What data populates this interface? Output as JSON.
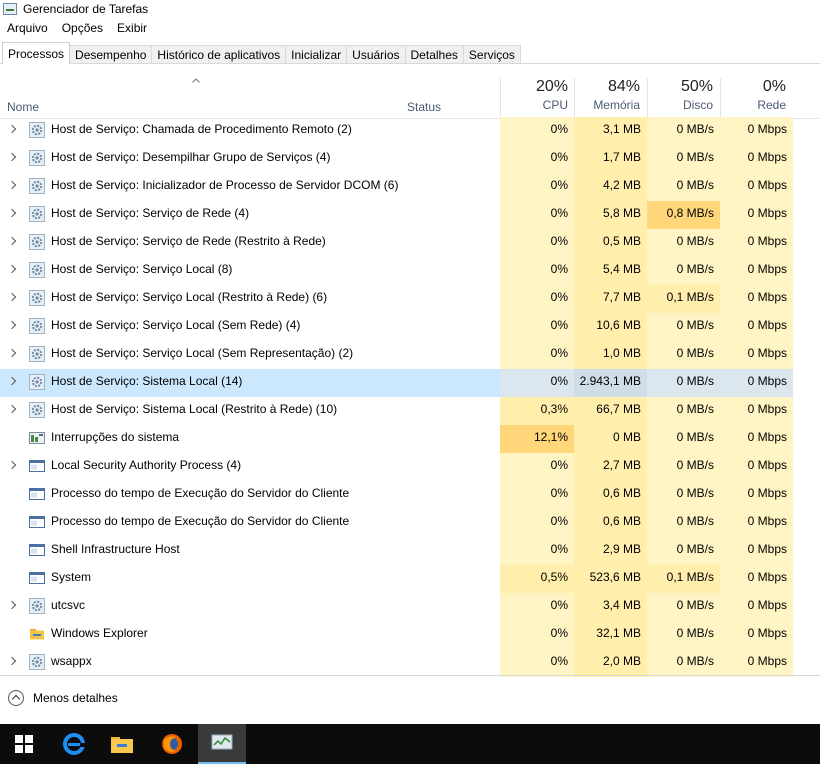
{
  "window": {
    "title": "Gerenciador de Tarefas"
  },
  "menu": [
    "Arquivo",
    "Opções",
    "Exibir"
  ],
  "tabs": [
    "Processos",
    "Desempenho",
    "Histórico de aplicativos",
    "Inicializar",
    "Usuários",
    "Detalhes",
    "Serviços"
  ],
  "header": {
    "name": "Nome",
    "status": "Status",
    "cpu": {
      "pct": "20%",
      "label": "CPU"
    },
    "memory": {
      "pct": "84%",
      "label": "Memória"
    },
    "disk": {
      "pct": "50%",
      "label": "Disco"
    },
    "network": {
      "pct": "0%",
      "label": "Rede"
    }
  },
  "rows": [
    {
      "name": "Host de Serviço: Chamada de Procedimento Remoto (2)",
      "cpu": "0%",
      "mem": "3,1 MB",
      "disk": "0 MB/s",
      "net": "0 Mbps"
    },
    {
      "name": "Host de Serviço: Desempilhar Grupo de Serviços (4)",
      "cpu": "0%",
      "mem": "1,7 MB",
      "disk": "0 MB/s",
      "net": "0 Mbps"
    },
    {
      "name": "Host de Serviço: Inicializador de Processo de Servidor DCOM (6)",
      "cpu": "0%",
      "mem": "4,2 MB",
      "disk": "0 MB/s",
      "net": "0 Mbps"
    },
    {
      "name": "Host de Serviço: Serviço de Rede (4)",
      "cpu": "0%",
      "mem": "5,8 MB",
      "disk": "0,8 MB/s",
      "net": "0 Mbps"
    },
    {
      "name": "Host de Serviço: Serviço de Rede (Restrito à Rede)",
      "cpu": "0%",
      "mem": "0,5 MB",
      "disk": "0 MB/s",
      "net": "0 Mbps"
    },
    {
      "name": "Host de Serviço: Serviço Local (8)",
      "cpu": "0%",
      "mem": "5,4 MB",
      "disk": "0 MB/s",
      "net": "0 Mbps"
    },
    {
      "name": "Host de Serviço: Serviço Local (Restrito à Rede) (6)",
      "cpu": "0%",
      "mem": "7,7 MB",
      "disk": "0,1 MB/s",
      "net": "0 Mbps"
    },
    {
      "name": "Host de Serviço: Serviço Local (Sem Rede) (4)",
      "cpu": "0%",
      "mem": "10,6 MB",
      "disk": "0 MB/s",
      "net": "0 Mbps"
    },
    {
      "name": "Host de Serviço: Serviço Local (Sem Representação) (2)",
      "cpu": "0%",
      "mem": "1,0 MB",
      "disk": "0 MB/s",
      "net": "0 Mbps"
    },
    {
      "name": "Host de Serviço: Sistema Local (14)",
      "cpu": "0%",
      "mem": "2.943,1 MB",
      "disk": "0 MB/s",
      "net": "0 Mbps"
    },
    {
      "name": "Host de Serviço: Sistema Local (Restrito à Rede) (10)",
      "cpu": "0,3%",
      "mem": "66,7 MB",
      "disk": "0 MB/s",
      "net": "0 Mbps"
    },
    {
      "name": "Interrupções do sistema",
      "cpu": "12,1%",
      "mem": "0 MB",
      "disk": "0 MB/s",
      "net": "0 Mbps"
    },
    {
      "name": "Local Security Authority Process (4)",
      "cpu": "0%",
      "mem": "2,7 MB",
      "disk": "0 MB/s",
      "net": "0 Mbps"
    },
    {
      "name": "Processo do tempo de Execução do Servidor do Cliente",
      "cpu": "0%",
      "mem": "0,6 MB",
      "disk": "0 MB/s",
      "net": "0 Mbps"
    },
    {
      "name": "Processo do tempo de Execução do Servidor do Cliente",
      "cpu": "0%",
      "mem": "0,6 MB",
      "disk": "0 MB/s",
      "net": "0 Mbps"
    },
    {
      "name": "Shell Infrastructure Host",
      "cpu": "0%",
      "mem": "2,9 MB",
      "disk": "0 MB/s",
      "net": "0 Mbps"
    },
    {
      "name": "System",
      "cpu": "0,5%",
      "mem": "523,6 MB",
      "disk": "0,1 MB/s",
      "net": "0 Mbps"
    },
    {
      "name": "utcsvc",
      "cpu": "0%",
      "mem": "3,4 MB",
      "disk": "0 MB/s",
      "net": "0 Mbps"
    },
    {
      "name": "Windows Explorer",
      "cpu": "0%",
      "mem": "32,1 MB",
      "disk": "0 MB/s",
      "net": "0 Mbps"
    },
    {
      "name": "wsappx",
      "cpu": "0%",
      "mem": "2,0 MB",
      "disk": "0 MB/s",
      "net": "0 Mbps"
    }
  ],
  "footer": {
    "less_details": "Menos detalhes"
  }
}
